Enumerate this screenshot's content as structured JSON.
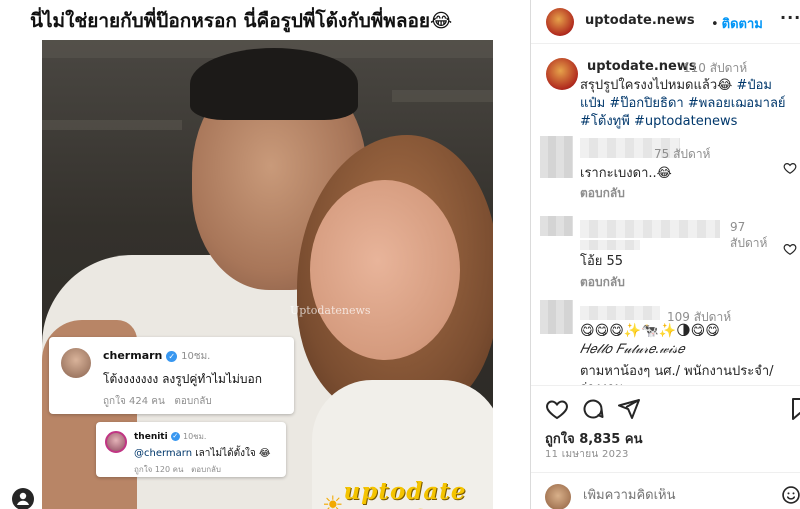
{
  "media": {
    "headline": "นี่ไม่ใช่ยายกับพี่ป๊อกหรอก นี่คือรูปพี่โต้งกับพี่พลอย😂",
    "photo_watermark": "Uptodatenews",
    "brand_logo_text": "uptodate NEWS",
    "overlay_comment_1": {
      "user": "chermarn",
      "time": "10ชม.",
      "text": "โต้งงงงงงง ลงรูปคู่ทำไมไม่บอก",
      "likes": "ถูกใจ 424 คน",
      "reply": "ตอบกลับ"
    },
    "overlay_comment_2": {
      "user": "theniti",
      "time": "10ชม.",
      "mention": "@chermarn",
      "text": "เลาไม่ได้ตั้งใจ 😂",
      "likes": "ถูกใจ 120 คน",
      "reply": "ตอบกลับ"
    }
  },
  "header": {
    "username": "uptodate.news",
    "dot": "•",
    "follow_label": "ติดตาม",
    "more": "···"
  },
  "caption": {
    "username": "uptodate.news",
    "time": "110 สัปดาห์",
    "text": "สรุปรูปใครงงไปหมดแล้ว😂",
    "hashtags": [
      "#ป๋อมแป๋ม",
      "#ป๊อกปิยธิดา",
      "#พลอยเฌอมาลย์",
      "#โต้งทูพี",
      "#uptodatenews"
    ]
  },
  "comments": [
    {
      "time": "75 สัปดาห์",
      "text": "เรากะเบงดา..😂",
      "reply": "ตอบกลับ"
    },
    {
      "time": "97 สัปดาห์",
      "text": "โอ้ย 55",
      "reply": "ตอบกลับ"
    },
    {
      "time": "109 สัปดาห์",
      "emojis": "😋😋😋✨🐄✨🌗😋😋",
      "bio": "𝐻𝑒𝓁𝓁𝑜 𝐹𝓊𝓉𝓊𝓇𝑒.𝓌𝒾𝓈𝑒",
      "text_line1": "ตามหาน้องๆ นศ./ พนักงานประจำ/",
      "text_line2": "ว่างงาน"
    }
  ],
  "actions": {
    "likes": "ถูกใจ 8,835 คน",
    "date": "11 เมษายน 2023"
  },
  "composer": {
    "placeholder": "เพิ่มความคิดเห็น"
  },
  "colors": {
    "link_blue": "#0095f6",
    "hashtag": "#00376b",
    "muted": "#8e8e8e",
    "text": "#262626"
  },
  "icons": [
    "heart-icon",
    "comment-icon",
    "share-icon",
    "bookmark-icon",
    "more-icon",
    "verified-icon",
    "user-tag-icon",
    "post-icon"
  ]
}
